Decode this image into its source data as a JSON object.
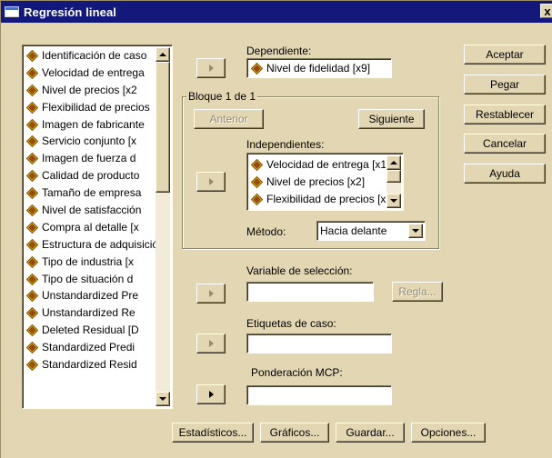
{
  "window": {
    "title": "Regresión lineal",
    "close_label": "x"
  },
  "variables": [
    "Identificación de caso",
    "Velocidad de entrega",
    "Nivel de precios [x2",
    "Flexibilidad de precios",
    "Imagen de fabricante",
    "Servicio conjunto [x",
    "Imagen de fuerza d",
    "Calidad de producto",
    "Tamaño de empresa",
    "Nivel de satisfacción",
    "Compra al detalle [x",
    "Estructura de adquisición",
    "Tipo de industria [x",
    "Tipo de situación d",
    "Unstandardized Pre",
    "Unstandardized Re",
    "Deleted Residual [D",
    "Standardized Predi",
    "Standardized Resid"
  ],
  "dependiente": {
    "label": "Dependiente:",
    "value": "Nivel de fidelidad [x9]"
  },
  "bloque": {
    "label": "Bloque 1 de 1",
    "anterior": "Anterior",
    "siguiente": "Siguiente"
  },
  "independientes": {
    "label": "Independientes:",
    "items": [
      "Velocidad de entrega [x1",
      "Nivel de precios [x2]",
      "Flexibilidad de precios [x3"
    ]
  },
  "metodo": {
    "label": "Método:",
    "value": "Hacia delante"
  },
  "seleccion": {
    "label": "Variable de selección:",
    "value": "",
    "regla": "Regla..."
  },
  "etiquetas": {
    "label": "Etiquetas de caso:",
    "value": ""
  },
  "ponderacion": {
    "label": "Ponderación MCP:",
    "value": ""
  },
  "side_buttons": {
    "aceptar": "Aceptar",
    "pegar": "Pegar",
    "restablecer": "Restablecer",
    "cancelar": "Cancelar",
    "ayuda": "Ayuda"
  },
  "bottom_buttons": {
    "estadisticos": "Estadísticos...",
    "graficos": "Gráficos...",
    "guardar": "Guardar...",
    "opciones": "Opciones..."
  },
  "colors": {
    "titlebar": "#13197a",
    "dialog_bg": "#e3d7b3",
    "variable_icon": "#d9a400"
  }
}
